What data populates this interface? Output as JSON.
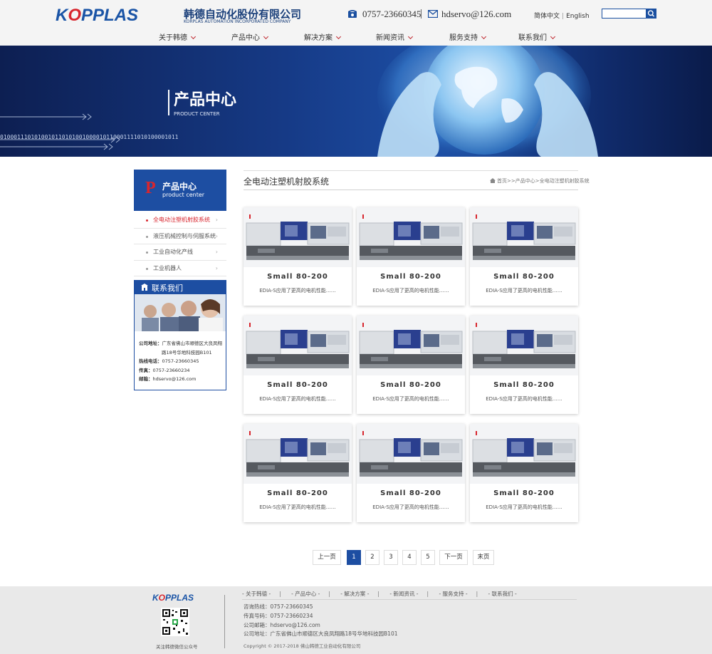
{
  "header": {
    "logo_text_a": "K",
    "logo_text_b": "O",
    "logo_text_c": "PPLAS",
    "company_cn": "韩德自动化股份有限公司",
    "company_en": "KORPLAS AUTOMATION INCORPORATED COMPANY",
    "phone": "0757-23660345",
    "email": "hdservo@126.com",
    "lang_cn": "简体中文",
    "lang_sep": "|",
    "lang_en": "English",
    "search_placeholder": ""
  },
  "nav": {
    "items": [
      {
        "label": "关于韩德"
      },
      {
        "label": "产品中心"
      },
      {
        "label": "解决方案"
      },
      {
        "label": "新闻资讯"
      },
      {
        "label": "服务支持"
      },
      {
        "label": "联系我们"
      }
    ]
  },
  "banner": {
    "title": "产品中心",
    "subtitle": "PRODUCT CENTER",
    "binary": "0100011101010010110101001000010110001111010100001011"
  },
  "sidebar": {
    "head_p": "P",
    "head_title": "产品中心",
    "head_sub": "product center",
    "items": [
      {
        "label": "全电动注塑机射胶系统",
        "arrow": "›"
      },
      {
        "label": "液压机械控制与伺服系统",
        "arrow": "›"
      },
      {
        "label": "工业自动化产线",
        "arrow": "›"
      },
      {
        "label": "工业机器人",
        "arrow": "›"
      }
    ],
    "contact_title": "联系我们",
    "contact": {
      "addr_label": "公司地址：",
      "addr_1": "广东省佛山市顺德区大良凤翔",
      "addr_2": "路18号华地科技园B101",
      "hotline_label": "热线电话：",
      "hotline": "0757-23660345",
      "fax_label": "传真：",
      "fax": "0757-23660234",
      "email_label": "邮箱：",
      "email": "hdservo@126.com"
    }
  },
  "main": {
    "title": "全电动注塑机射胶系统",
    "breadcrumb": "首页>>产品中心>全电动注塑机射胶系统",
    "cards": [
      {
        "title": "Small 80-200",
        "desc": "EDIA-S应用了更高的电机性能……"
      },
      {
        "title": "Small 80-200",
        "desc": "EDIA-S应用了更高的电机性能……"
      },
      {
        "title": "Small 80-200",
        "desc": "EDIA-S应用了更高的电机性能……"
      },
      {
        "title": "Small 80-200",
        "desc": "EDIA-S应用了更高的电机性能……"
      },
      {
        "title": "Small 80-200",
        "desc": "EDIA-S应用了更高的电机性能……"
      },
      {
        "title": "Small 80-200",
        "desc": "EDIA-S应用了更高的电机性能……"
      },
      {
        "title": "Small 80-200",
        "desc": "EDIA-S应用了更高的电机性能……"
      },
      {
        "title": "Small 80-200",
        "desc": "EDIA-S应用了更高的电机性能……"
      },
      {
        "title": "Small 80-200",
        "desc": "EDIA-S应用了更高的电机性能……"
      }
    ]
  },
  "pagination": {
    "prev": "上一页",
    "pages": [
      "1",
      "2",
      "3",
      "4",
      "5"
    ],
    "current": "1",
    "next": "下一页",
    "last": "末页"
  },
  "footer": {
    "logo_a": "K",
    "logo_b": "O",
    "logo_c": "PPLAS",
    "qr_caption": "关注韩德微信公众号",
    "nav": [
      "- 关于韩德 -",
      "- 产品中心 -",
      "- 解决方案 -",
      "- 新闻资讯 -",
      "- 服务支持 -",
      "- 联系我们 -"
    ],
    "nav_sep": "|",
    "consult": "咨询热线：0757-23660345",
    "fax": "传真号码：0757-23660234",
    "email": "公司邮箱：hdservo@126.com",
    "address": "公司地址：广东省佛山市顺德区大良凤翔路18号华地科技园B101",
    "copyright": "Copyright © 2017-2018 佛山韩德工业自动化有限公司"
  },
  "colors": {
    "brand_blue": "#1d4ea2",
    "accent_red": "#d8262e"
  }
}
